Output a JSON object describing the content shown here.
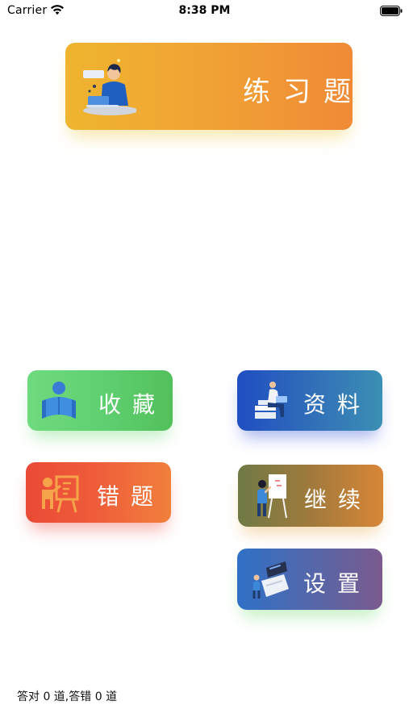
{
  "status_bar": {
    "carrier": "Carrier",
    "time": "8:38 PM",
    "icons": [
      "wifi-icon",
      "battery-icon"
    ]
  },
  "buttons": {
    "practice": {
      "label": "练习题",
      "illustration": "person-at-laptop-illustration",
      "colors": [
        "#efb52f",
        "#f08a36"
      ]
    },
    "favorites": {
      "label": "收藏",
      "illustration": "person-reading-book-illustration",
      "colors": [
        "#6fda7e",
        "#52c05a"
      ]
    },
    "materials": {
      "label": "资料",
      "illustration": "person-on-books-illustration",
      "colors": [
        "#1f4ec1",
        "#3b8fb4"
      ]
    },
    "wrong": {
      "label": "错题",
      "illustration": "teacher-at-board-illustration",
      "colors": [
        "#ea4a36",
        "#f0803c"
      ]
    },
    "continue": {
      "label": "继续",
      "illustration": "person-at-whiteboard-illustration",
      "colors": [
        "#6f7a45",
        "#d88637"
      ]
    },
    "settings": {
      "label": "设置",
      "illustration": "person-at-control-panel-illustration",
      "colors": [
        "#2f71c7",
        "#7b5a8e"
      ]
    }
  },
  "footer": {
    "stats": "答对 0 道,答错 0 道"
  }
}
